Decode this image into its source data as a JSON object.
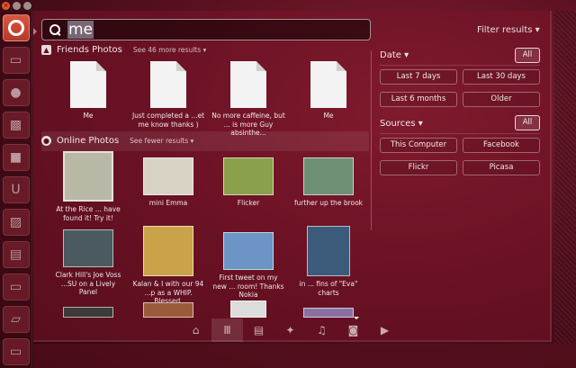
{
  "window_controls": {
    "close": "×",
    "minimize": "",
    "maximize": ""
  },
  "launcher": {
    "items": [
      {
        "name": "dash-home",
        "glyph": ""
      },
      {
        "name": "files",
        "glyph": "▭"
      },
      {
        "name": "firefox",
        "glyph": "●"
      },
      {
        "name": "music",
        "glyph": "▩"
      },
      {
        "name": "text",
        "glyph": "■"
      },
      {
        "name": "ubuntu-one",
        "glyph": "U"
      },
      {
        "name": "image",
        "glyph": "▨"
      },
      {
        "name": "software",
        "glyph": "▤"
      },
      {
        "name": "doc",
        "glyph": "▭"
      },
      {
        "name": "workspaces",
        "glyph": "▱"
      },
      {
        "name": "terminal",
        "glyph": "▭"
      },
      {
        "name": "trash",
        "glyph": "▭"
      }
    ]
  },
  "search": {
    "value": "me"
  },
  "filter": {
    "toggle_label": "Filter results",
    "toggle_arrow": "▾"
  },
  "friends": {
    "title": "Friends Photos",
    "more": "See 46 more results",
    "more_arrow": "▾",
    "items": [
      {
        "caption": "Me"
      },
      {
        "caption": "Just completed a ...et me know thanks )"
      },
      {
        "caption": "No more caffeine, but ... is more Guy absinthe..."
      },
      {
        "caption": "Me"
      }
    ]
  },
  "online": {
    "title": "Online Photos",
    "more": "See fewer results",
    "more_arrow": "▾",
    "items": [
      {
        "caption": "At the Rice ... have found it! Try it!",
        "color": "#b9b7a6"
      },
      {
        "caption": "mini Emma",
        "color": "#d8d3c4"
      },
      {
        "caption": "Flicker",
        "color": "#8aa04a"
      },
      {
        "caption": "further up the brook",
        "color": "#6f8f74"
      },
      {
        "caption": "Clark Hill's Joe Voss ...SU on a Lively Panel",
        "color": "#4a5a5e"
      },
      {
        "caption": "Kalan & I with our 94 ...p as a WHIP. Blessed.",
        "color": "#caa24a"
      },
      {
        "caption": "First tweet on my new ... room! Thanks Nokia",
        "color": "#6c94c4"
      },
      {
        "caption": "in ... fins of \"Eva\" charts",
        "color": "#3c5a7a"
      }
    ]
  },
  "filters": {
    "date": {
      "title": "Date",
      "arrow": "▾",
      "all": "All",
      "options": [
        "Last 7 days",
        "Last 30 days",
        "Last 6 months",
        "Older"
      ]
    },
    "sources": {
      "title": "Sources",
      "arrow": "▾",
      "all": "All",
      "options": [
        "This Computer",
        "Facebook",
        "Flickr",
        "Picasa"
      ]
    }
  },
  "lenses": [
    {
      "name": "home",
      "glyph": "⌂"
    },
    {
      "name": "applications",
      "glyph": "Ⅲ"
    },
    {
      "name": "files",
      "glyph": "▤"
    },
    {
      "name": "social",
      "glyph": "✦"
    },
    {
      "name": "music",
      "glyph": "♫"
    },
    {
      "name": "photos",
      "glyph": "◙"
    },
    {
      "name": "video",
      "glyph": "▶"
    }
  ]
}
